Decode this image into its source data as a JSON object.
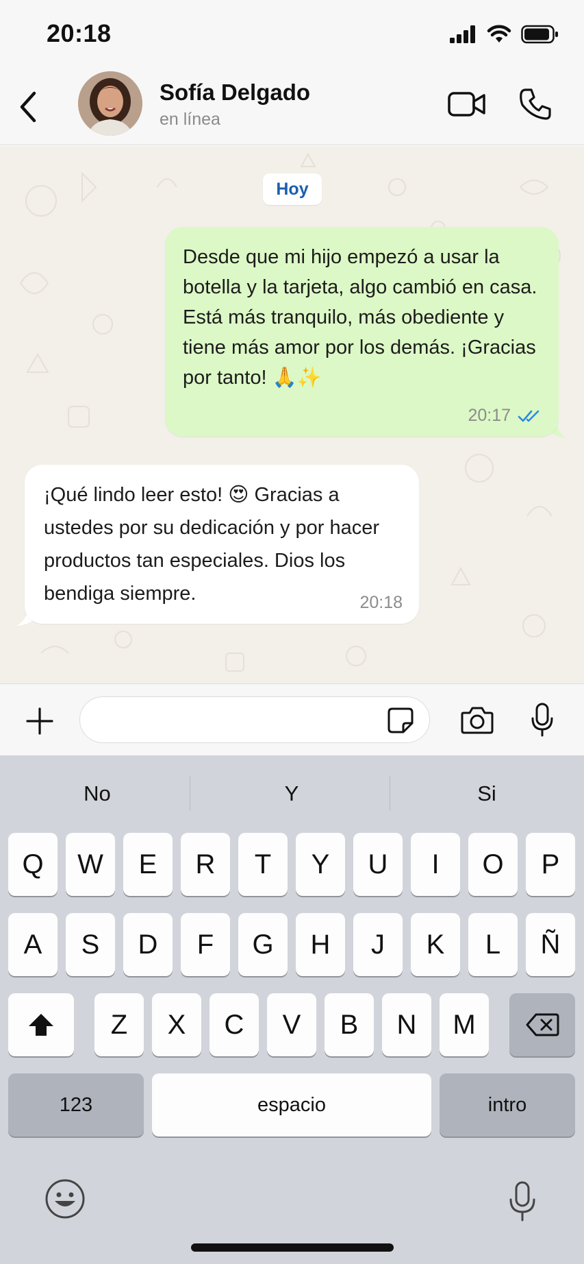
{
  "status_bar": {
    "time": "20:18",
    "icons": [
      "signal-icon",
      "wifi-icon",
      "battery-icon"
    ]
  },
  "header": {
    "back_icon": "chevron-left-icon",
    "contact_name": "Sofía Delgado",
    "contact_status": "en línea",
    "video_icon": "video-camera-icon",
    "call_icon": "phone-icon"
  },
  "chat": {
    "date_chip": "Hoy",
    "messages": [
      {
        "direction": "outgoing",
        "text": "Desde que mi hijo empezó a usar la botella y la tarjeta, algo cambió en casa. Está más tranquilo, más obediente y tiene más amor por los demás. ¡Gracias por tanto! 🙏✨",
        "time": "20:17",
        "status_icon": "double-check-icon",
        "status_color": "#2a8be4"
      },
      {
        "direction": "incoming",
        "text": "¡Qué lindo leer esto! 😍 Gracias a ustedes por su dedicación y por hacer productos tan especiales. Dios los bendiga siempre.",
        "time": "20:18"
      }
    ],
    "bubble_out_color": "#dcf8c6",
    "bubble_in_color": "#ffffff",
    "background_color": "#f3efe9"
  },
  "input_bar": {
    "plus_icon": "plus-icon",
    "placeholder": "",
    "sticker_icon": "sticker-icon",
    "camera_icon": "camera-icon",
    "mic_icon": "microphone-icon"
  },
  "keyboard": {
    "suggestions": [
      "No",
      "Y",
      "Si"
    ],
    "row1": [
      "Q",
      "W",
      "E",
      "R",
      "T",
      "Y",
      "U",
      "I",
      "O",
      "P"
    ],
    "row2": [
      "A",
      "S",
      "D",
      "F",
      "G",
      "H",
      "J",
      "K",
      "L",
      "Ñ"
    ],
    "row3": [
      "Z",
      "X",
      "C",
      "V",
      "B",
      "N",
      "M"
    ],
    "shift_icon": "shift-icon",
    "backspace_icon": "backspace-icon",
    "numbers_label": "123",
    "space_label": "espacio",
    "return_label": "intro",
    "emoji_icon": "emoji-icon",
    "dictation_icon": "microphone-icon"
  }
}
